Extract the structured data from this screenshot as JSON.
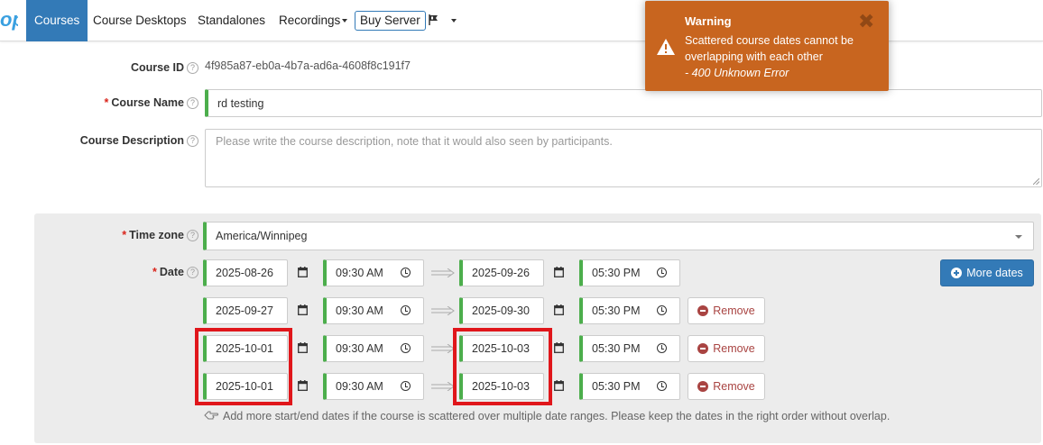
{
  "nav": {
    "brand": "op",
    "items": [
      {
        "label": "Courses",
        "active": true
      },
      {
        "label": "Course Desktops"
      },
      {
        "label": "Standalones"
      },
      {
        "label": "Recordings"
      }
    ],
    "buy_label": "Buy Server",
    "lang_icon": "language-flag-icon"
  },
  "form": {
    "course_id_label": "Course ID",
    "course_id_value": "4f985a87-eb0a-4b7a-ad6a-4608f8c191f7",
    "course_name_label": "Course Name",
    "course_name_value": "rd testing",
    "course_desc_label": "Course Description",
    "course_desc_placeholder": "Please write the course description, note that it would also seen by participants.",
    "timezone_label": "Time zone",
    "timezone_value": "America/Winnipeg",
    "date_label": "Date",
    "help_glyph": "?",
    "required_mark": "*",
    "dates": [
      {
        "start_date": "2025-08-26",
        "start_time": "09:30 AM",
        "end_date": "2025-09-26",
        "end_time": "05:30 PM"
      },
      {
        "start_date": "2025-09-27",
        "start_time": "09:30 AM",
        "end_date": "2025-09-30",
        "end_time": "05:30 PM"
      },
      {
        "start_date": "2025-10-01",
        "start_time": "09:30 AM",
        "end_date": "2025-10-03",
        "end_time": "05:30 PM"
      },
      {
        "start_date": "2025-10-01",
        "start_time": "09:30 AM",
        "end_date": "2025-10-03",
        "end_time": "05:30 PM"
      }
    ],
    "remove_label": "Remove",
    "more_dates_label": "More dates",
    "hint": "Add more start/end dates if the course is scattered over multiple date ranges. Please keep the dates in the right order without overlap."
  },
  "toast": {
    "title": "Warning",
    "message": "Scattered course dates cannot be overlapping with each other",
    "error": "- 400 Unknown Error",
    "close_glyph": "✖"
  },
  "colors": {
    "primary": "#337ab7",
    "valid_border": "#4cae4c",
    "warning_bg": "#c8651f",
    "danger": "#a94442",
    "highlight": "#e0161b"
  }
}
